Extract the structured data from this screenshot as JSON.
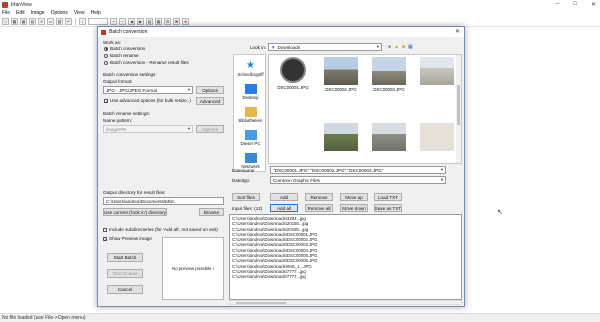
{
  "app": {
    "title": "IrfanView",
    "status": "No file loaded (use File->Open menu)"
  },
  "menu": [
    "File",
    "Edit",
    "Image",
    "Options",
    "View",
    "Help"
  ],
  "dialog": {
    "title": "Batch conversion",
    "work_as": {
      "label": "Work as:",
      "options": [
        "Batch conversion",
        "Batch rename",
        "Batch conversion - Rename result files"
      ]
    },
    "conversion": {
      "section": "Batch conversion settings:",
      "output_format_label": "Output format:",
      "format_value": "JPG - JPG/JPEG Format",
      "options_button": "Options",
      "advanced_checkbox": "Use advanced options (for bulk resize..)",
      "advanced_button": "Advanced"
    },
    "rename": {
      "section": "Batch rename settings:",
      "pattern_label": "Name pattern:",
      "pattern_value": "image###",
      "options_button": "Options"
    },
    "output": {
      "label": "Output directory for result files:",
      "path": "C:\\Users\\andrea\\Documents\\Misc",
      "use_current_button": "Use current ('look in') directory",
      "browse_button": "Browse"
    },
    "include_subdirs": "Include subdirectories (for 'Add all', not saved on exit)",
    "show_preview": "Show Preview image",
    "start_button": "Start Batch",
    "test_button": "Test rename",
    "cancel_button": "Cancel",
    "preview_text": "No preview possible !",
    "browser": {
      "look_in_label": "Look in:",
      "folder": "Downloads",
      "places": [
        "Schnellzugriff",
        "Desktop",
        "Bibliotheken",
        "Dieser PC",
        "Netzwerk"
      ],
      "thumbs": [
        "DSC00001.JPG",
        "DSC00002.JPG",
        "DSC00003.JPG",
        "",
        "",
        ""
      ],
      "filename_label": "Dateiname:",
      "filename_value": "\"DSC00001.JPG\" \"DSC00002.JPG\" \"DSC00003.JPG\"",
      "filetype_label": "Dateityp:",
      "filetype_value": "Common Graphic Files"
    },
    "buttons": {
      "sort_files": "Sort files",
      "add": "Add",
      "remove": "Remove",
      "move_up": "Move up",
      "load_txt": "Load TXT",
      "add_all": "Add all",
      "remove_all": "Remove all",
      "move_down": "Move down",
      "save_txt": "Save as TXT"
    },
    "input_files_label": "Input files: (12)",
    "input_files": [
      "C:\\Users\\andrea\\Downloads\\3294...jpg",
      "C:\\Users\\andrea\\Downloads\\20180...jpg",
      "C:\\Users\\andrea\\Downloads\\20180...jpg",
      "C:\\Users\\andrea\\Downloads\\DSC00001.JPG",
      "C:\\Users\\andrea\\Downloads\\DSC00002.JPG",
      "C:\\Users\\andrea\\Downloads\\DSC00003.JPG",
      "C:\\Users\\andrea\\Downloads\\DSC00004.JPG",
      "C:\\Users\\andrea\\Downloads\\DSC00005.JPG",
      "C:\\Users\\andrea\\Downloads\\DSC00006.JPG",
      "C:\\Users\\andrea\\Downloads\\IMG_1...JPG",
      "C:\\Users\\andrea\\Downloads\\7777...jpg",
      "C:\\Users\\andrea\\Downloads\\7777...jpg"
    ]
  }
}
